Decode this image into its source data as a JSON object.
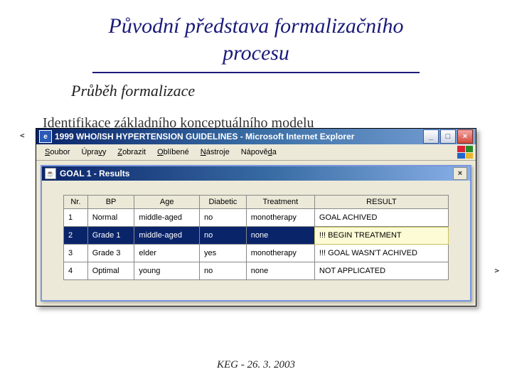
{
  "slide": {
    "title_line1": "Původní představa formalizačního",
    "title_line2": "procesu",
    "subtitle": "Průběh formalizace",
    "partial_text": "Identifikace základního konceptuálního modelu",
    "footer": "KEG - 26. 3. 2003",
    "xml_left": "<",
    "xml_right": ">"
  },
  "ie_window": {
    "title": "1999 WHO/ISH HYPERTENSION GUIDELINES - Microsoft Internet Explorer",
    "menu": [
      {
        "label": "Soubor",
        "accel": "S"
      },
      {
        "label": "Úpravy",
        "accel": "v"
      },
      {
        "label": "Zobrazit",
        "accel": "Z"
      },
      {
        "label": "Oblíbené",
        "accel": "O"
      },
      {
        "label": "Nástroje",
        "accel": "N"
      },
      {
        "label": "Nápověda",
        "accel": "d"
      }
    ]
  },
  "inner_window": {
    "title": "GOAL 1 - Results"
  },
  "table": {
    "headers": [
      "Nr.",
      "BP",
      "Age",
      "Diabetic",
      "Treatment",
      "RESULT"
    ],
    "rows": [
      {
        "nr": "1",
        "bp": "Normal",
        "age": "middle-aged",
        "diabetic": "no",
        "treatment": "monotherapy",
        "result": "GOAL ACHIVED",
        "selected": false
      },
      {
        "nr": "2",
        "bp": "Grade 1",
        "age": "middle-aged",
        "diabetic": "no",
        "treatment": "none",
        "result": "!!! BEGIN TREATMENT",
        "selected": true
      },
      {
        "nr": "3",
        "bp": "Grade 3",
        "age": "elder",
        "diabetic": "yes",
        "treatment": "monotherapy",
        "result": "!!! GOAL WASN'T ACHIVED",
        "selected": false
      },
      {
        "nr": "4",
        "bp": "Optimal",
        "age": "young",
        "diabetic": "no",
        "treatment": "none",
        "result": "NOT APPLICATED",
        "selected": false
      }
    ]
  }
}
